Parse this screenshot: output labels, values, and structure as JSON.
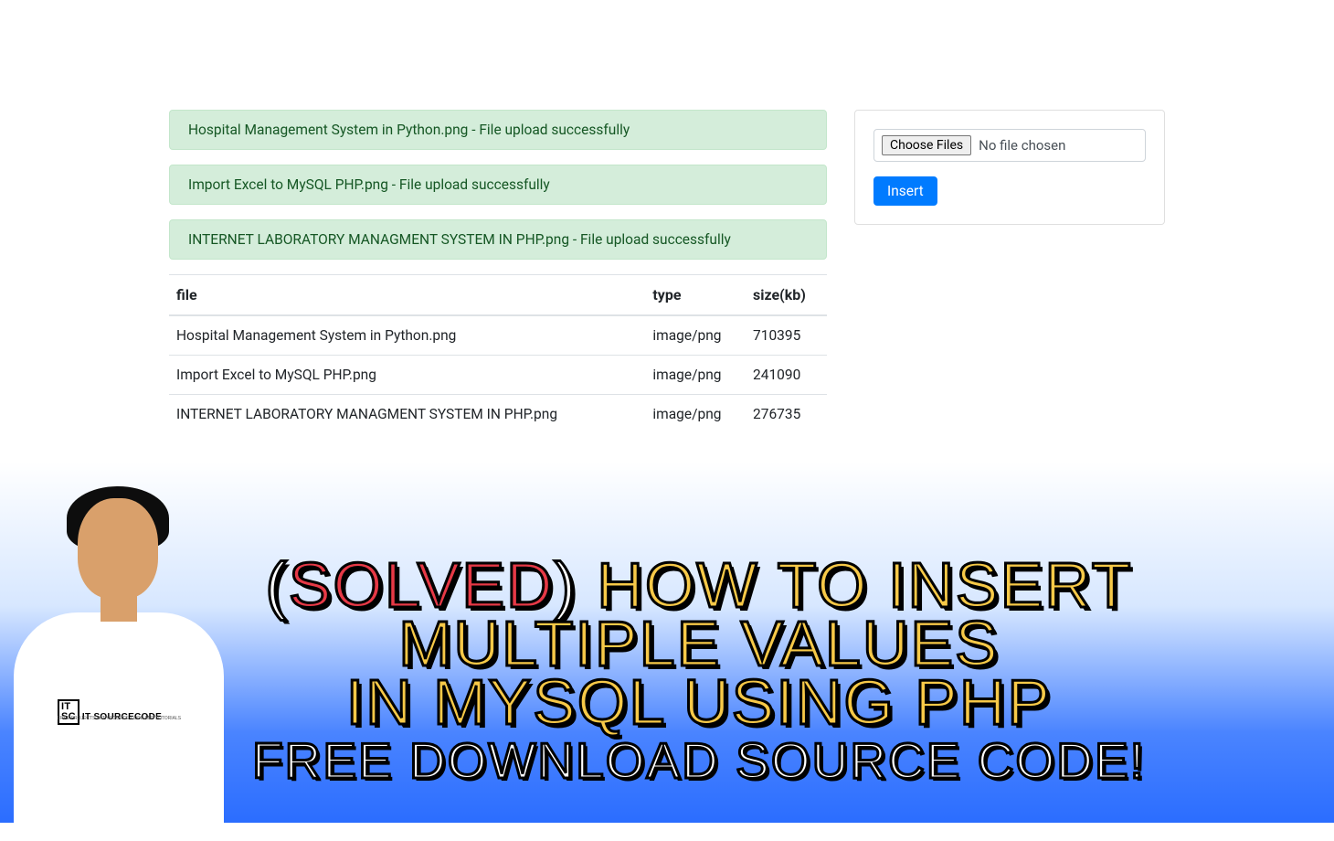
{
  "alerts": [
    "Hospital Management System in Python.png - File upload successfully",
    "Import Excel to MySQL PHP.png - File upload successfully",
    "INTERNET LABORATORY MANAGMENT SYSTEM IN PHP.png - File upload successfully"
  ],
  "table": {
    "headers": {
      "file": "file",
      "type": "type",
      "size": "size(kb)"
    },
    "rows": [
      {
        "file": "Hospital Management System in Python.png",
        "type": "image/png",
        "size": "710395"
      },
      {
        "file": "Import Excel to MySQL PHP.png",
        "type": "image/png",
        "size": "241090"
      },
      {
        "file": "INTERNET LABORATORY MANAGMENT SYSTEM IN PHP.png",
        "type": "image/png",
        "size": "276735"
      }
    ]
  },
  "upload_panel": {
    "choose_label": "Choose Files",
    "file_status": "No file chosen",
    "submit_label": "Insert"
  },
  "banner": {
    "paren_open": "(",
    "solved": "SOLVED",
    "paren_close": ")",
    "rest1": " HOW TO INSERT",
    "line2": "MULTIPLE VALUES",
    "line3": "IN MYSQL USING PHP",
    "line4": "FREE DOWNLOAD SOURCE CODE!"
  },
  "person_logo": {
    "box": "IT\nSC",
    "text": "IT SOURCECODE",
    "sub": "FREE PROJECTS WITH SOURCE CODE AND TUTORIALS"
  }
}
